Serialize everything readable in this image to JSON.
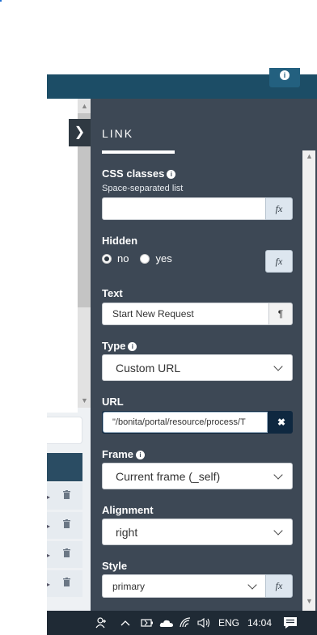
{
  "app": {
    "header_info": "i"
  },
  "panel": {
    "title": "LINK",
    "css_classes": {
      "label": "CSS classes",
      "hint": "Space-separated list",
      "value": "",
      "fx": "fx"
    },
    "hidden": {
      "label": "Hidden",
      "options": [
        "no",
        "yes"
      ],
      "selected": "no",
      "fx": "fx"
    },
    "text": {
      "label": "Text",
      "value": "Start New Request",
      "toggle": "¶"
    },
    "type": {
      "label": "Type",
      "value": "Custom URL"
    },
    "url": {
      "label": "URL",
      "value": "\"/bonita/portal/resource/process/T",
      "clear": "✖"
    },
    "frame": {
      "label": "Frame",
      "value": "Current frame (_self)"
    },
    "alignment": {
      "label": "Alignment",
      "value": "right"
    },
    "style": {
      "label": "Style",
      "value": "primary",
      "fx": "fx"
    }
  },
  "taskbar": {
    "language": "ENG",
    "time": "14:04"
  },
  "colors": {
    "panel_bg": "#3d4855",
    "header_bg": "#1c4d66",
    "url_dark": "#0f2840"
  }
}
